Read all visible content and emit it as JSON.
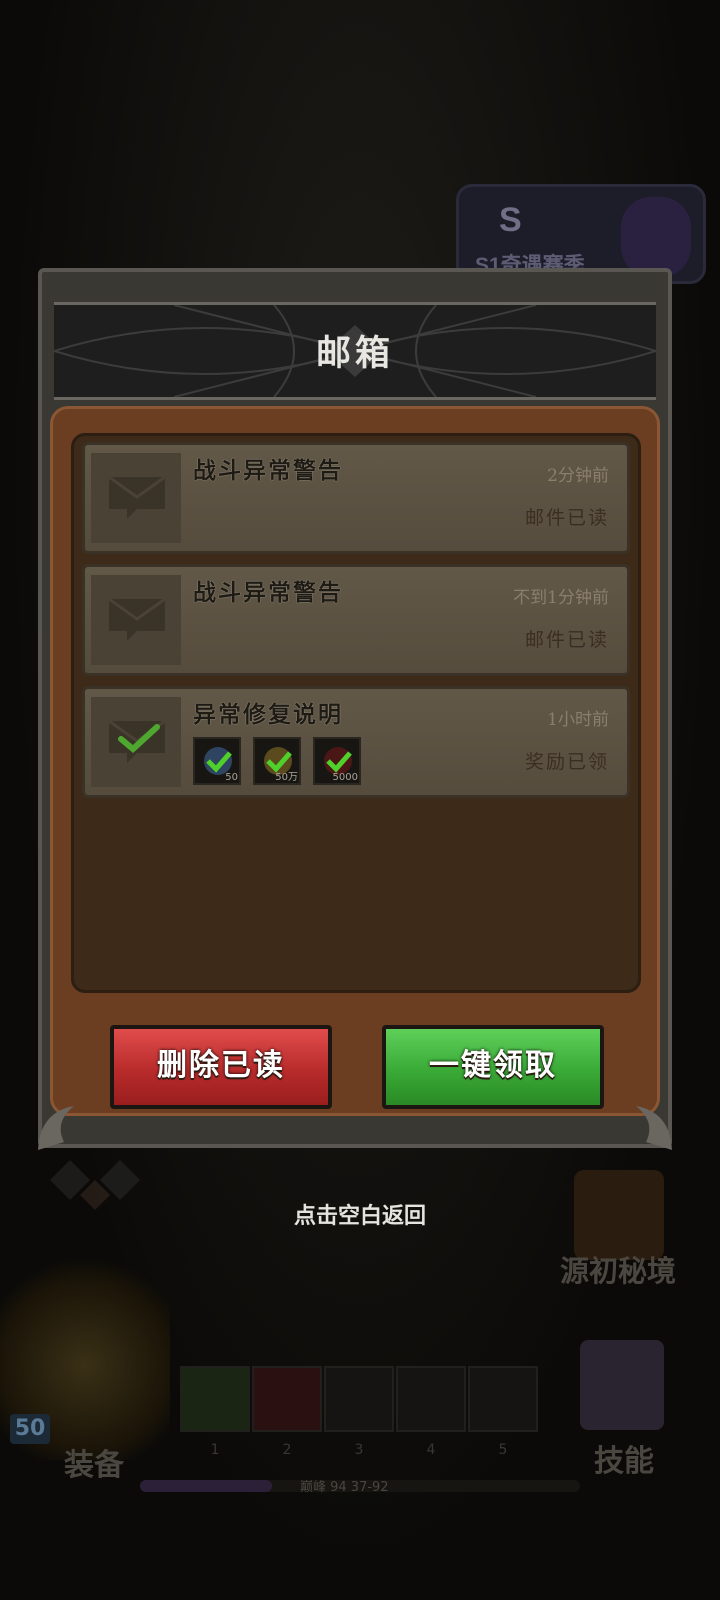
{
  "background": {
    "season_badge": "S1奇遇赛季",
    "secret_realm_label": "源初秘境",
    "equip_label": "装备",
    "skill_label": "技能",
    "level": "50",
    "skill_slot_numbers": [
      "1",
      "2",
      "3",
      "4",
      "5"
    ],
    "exp_text": "巅峰  94   37-92",
    "exp_progress": 0.3
  },
  "dialog": {
    "title": "邮箱",
    "mails": [
      {
        "title": "战斗异常警告",
        "time": "2分钟前",
        "status": "邮件已读",
        "icon": "envelope-icon"
      },
      {
        "title": "战斗异常警告",
        "time": "不到1分钟前",
        "status": "邮件已读",
        "icon": "envelope-icon"
      },
      {
        "title": "异常修复说明",
        "time": "1小时前",
        "status": "奖励已领",
        "icon": "envelope-check-icon",
        "rewards": [
          {
            "qty": "50"
          },
          {
            "qty": "50万"
          },
          {
            "qty": "5000"
          }
        ]
      }
    ],
    "delete_read_label": "删除已读",
    "claim_all_label": "一键领取"
  },
  "tap_hint": "点击空白返回",
  "colors": {
    "delete_button": "#c83434",
    "claim_button": "#3fae3a",
    "panel": "#6b3e22"
  }
}
